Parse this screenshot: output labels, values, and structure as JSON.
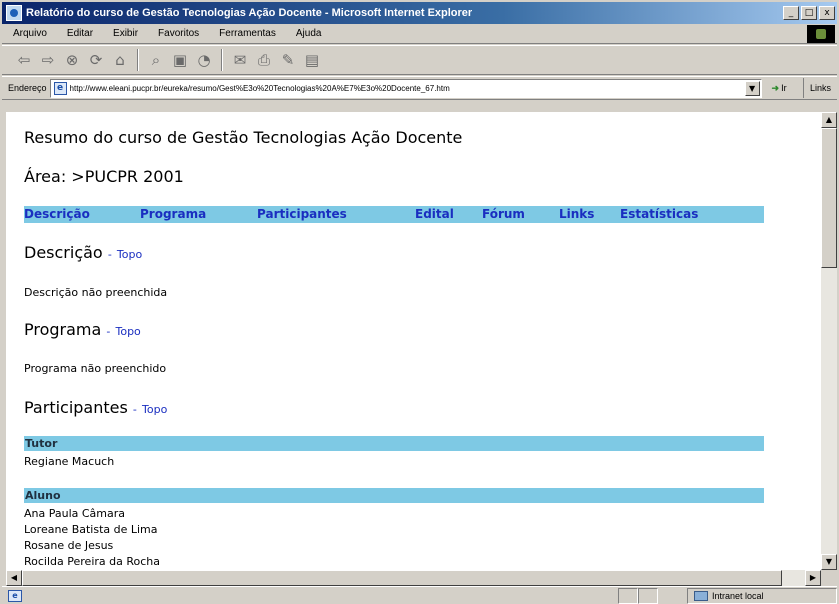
{
  "window": {
    "title": "Relatório do curso de Gestão Tecnologias Ação Docente - Microsoft Internet Explorer",
    "caption_buttons": {
      "minimize": "_",
      "maximize": "□",
      "close": "x"
    }
  },
  "menu": {
    "items": [
      "Arquivo",
      "Editar",
      "Exibir",
      "Favoritos",
      "Ferramentas",
      "Ajuda"
    ]
  },
  "toolbar": {
    "icons": [
      "back-icon",
      "forward-icon",
      "stop-icon",
      "refresh-icon",
      "home-icon",
      "search-icon",
      "favorites-icon",
      "history-icon",
      "mail-icon",
      "print-icon",
      "edit-icon",
      "discuss-icon"
    ]
  },
  "address": {
    "label": "Endereço",
    "url": "http://www.eleani.pucpr.br/eureka/resumo/Gest%E3o%20Tecnologias%20A%E7%E3o%20Docente_67.htm",
    "go_label": "Ir",
    "links_label": "Links"
  },
  "page": {
    "course_title": "Resumo do curso de Gestão Tecnologias Ação Docente",
    "area_line": "Área: >PUCPR 2001",
    "nav": [
      "Descrição",
      "Programa",
      "Participantes",
      "Edital",
      "Fórum",
      "Links",
      "Estatísticas"
    ],
    "sections": {
      "descricao": {
        "heading": "Descrição",
        "separator": "-",
        "topo": "Topo",
        "text": "Descrição não preenchida"
      },
      "programa": {
        "heading": "Programa",
        "separator": "-",
        "topo": "Topo",
        "text": "Programa não preenchido"
      },
      "participantes": {
        "heading": "Participantes",
        "separator": "-",
        "topo": "Topo"
      }
    },
    "tutor_header": "Tutor",
    "tutors": [
      "Regiane Macuch"
    ],
    "aluno_header": "Aluno",
    "alunos": [
      "Ana Paula Câmara",
      "Loreane Batista de Lima",
      "Rosane de Jesus",
      "Rocilda Pereira da Rocha"
    ]
  },
  "status": {
    "zone": "Intranet local"
  }
}
